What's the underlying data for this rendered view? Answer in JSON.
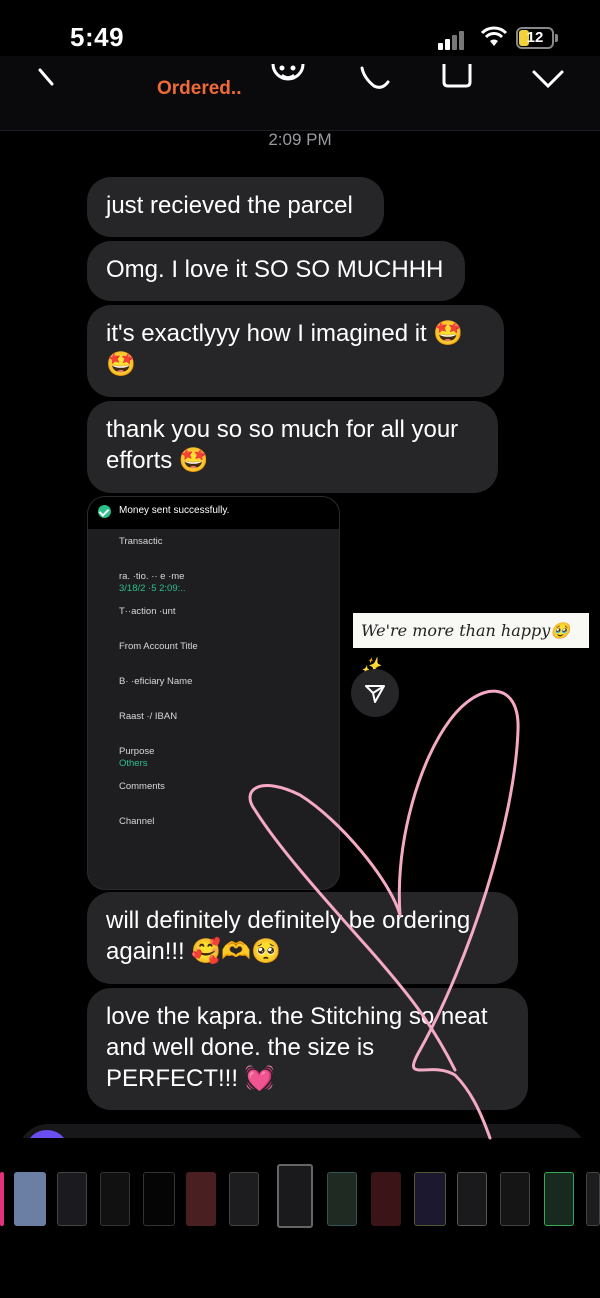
{
  "status_bar": {
    "time": "5:49",
    "battery": "12"
  },
  "header": {
    "title": "Ordered.."
  },
  "timestamp": "2:09 PM",
  "messages": [
    {
      "text": "just recieved the parcel"
    },
    {
      "text": "Omg. I love it SO SO MUCHHH"
    },
    {
      "text": "it's exactlyyy how I imagined it 🤩 🤩"
    },
    {
      "text": "thank you so so much for all your efforts 🤩"
    },
    {
      "text": "will definitely definitely be ordering again!!! 🥰🫶🥺"
    },
    {
      "text": "love the kapra. the Stitching so neat and well done. the size is PERFECT!!! 💓"
    }
  ],
  "payment_screenshot": {
    "title": "Money sent successfully.",
    "rows": [
      "Transactic",
      "ra. ·tio. ·· e ·me",
      "3/18/2 ·5 2:09:..",
      "T··action ·unt",
      "From Account Title",
      "B· ·eficiary Name",
      "Raast ·/ IBAN",
      "Purpose",
      "Others",
      "Comments",
      "Channel"
    ]
  },
  "sticker_text": "We're more than happy🥹✨",
  "colors": {
    "accent": "#f06a38",
    "bubble": "#262629",
    "heart": "#f4a9c6"
  },
  "icons": [
    "back-chevron-icon",
    "smiley-icon",
    "phone-icon",
    "video-icon",
    "chevron-down-icon",
    "share-icon",
    "heart-doodle"
  ]
}
